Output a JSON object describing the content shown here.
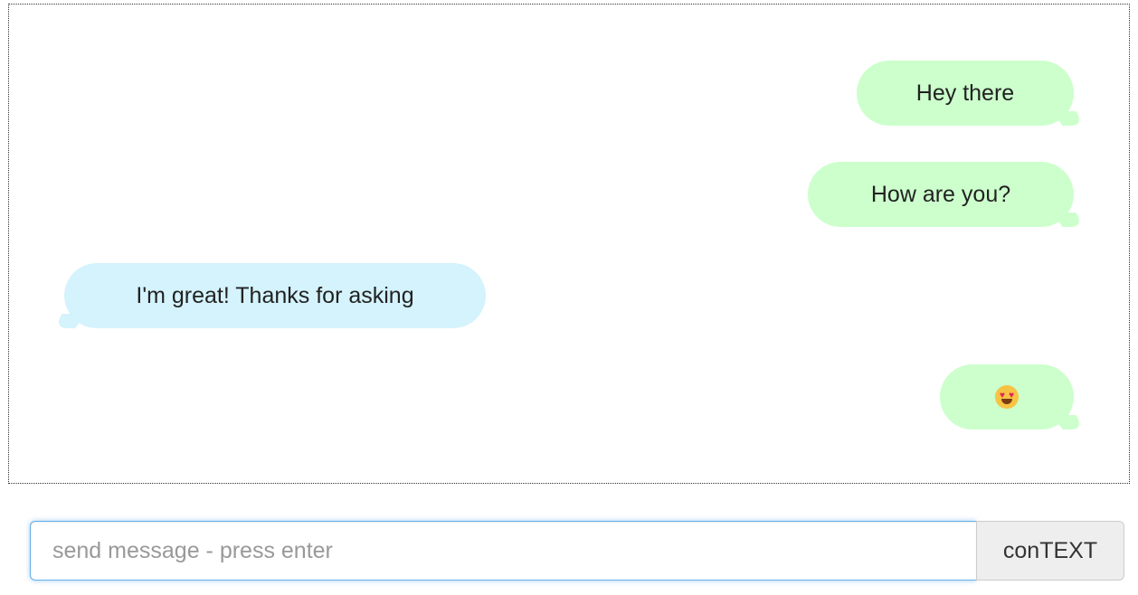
{
  "chat": {
    "messages": [
      {
        "side": "sent",
        "text": "Hey there"
      },
      {
        "side": "sent",
        "text": "How are you?"
      },
      {
        "side": "received",
        "text": "I'm great! Thanks for asking"
      },
      {
        "side": "sent",
        "icon": "heart-eyes-emoji-icon"
      }
    ]
  },
  "composer": {
    "placeholder": "send message - press enter",
    "value": "",
    "button_label": "conTEXT"
  },
  "colors": {
    "sent_bubble": "#ccffcc",
    "received_bubble": "#d4f3fc",
    "input_focus_border": "#66afe9"
  }
}
